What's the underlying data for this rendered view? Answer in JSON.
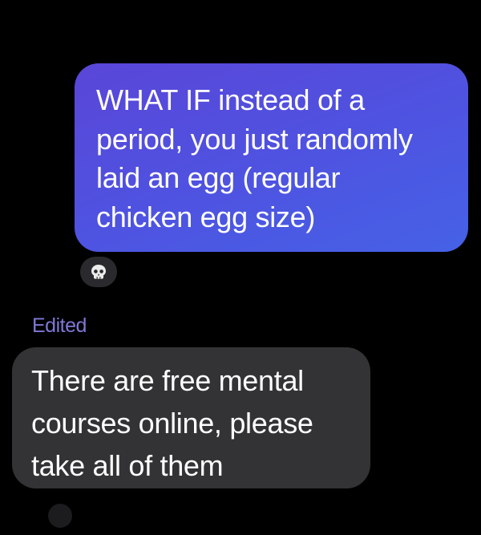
{
  "conversation": {
    "sent_message": {
      "lines": [
        "WHAT IF instead of a",
        "period, you just randomly",
        "laid an egg (regular",
        "chicken egg size)"
      ],
      "bubble_color": "#5a4fdd"
    },
    "reaction": {
      "icon": "skull-icon"
    },
    "edited_label": "Edited",
    "received_message": {
      "lines": [
        "There are free mental",
        "courses online, please",
        "take all of them"
      ],
      "bubble_color": "#333335"
    }
  },
  "colors": {
    "background": "#000000",
    "edited_label": "#7f78d6"
  }
}
